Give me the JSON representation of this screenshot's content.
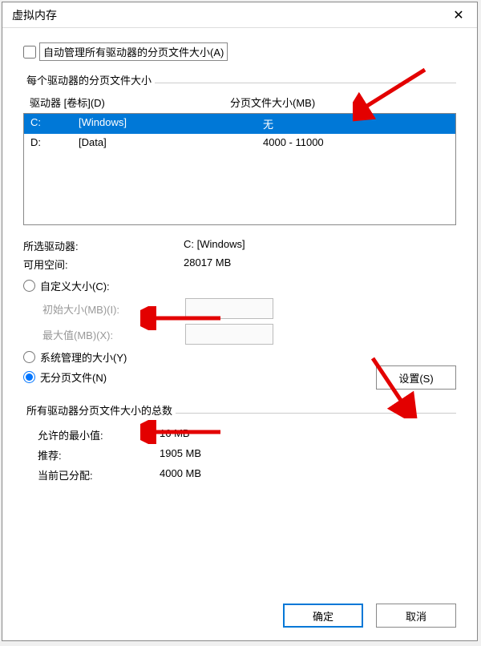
{
  "title": "虚拟内存",
  "auto_manage_label": "自动管理所有驱动器的分页文件大小(A)",
  "group1_label": "每个驱动器的分页文件大小",
  "drive_header_left": "驱动器 [卷标](D)",
  "drive_header_right": "分页文件大小(MB)",
  "drives": [
    {
      "letter": "C:",
      "label": "[Windows]",
      "size": "无",
      "selected": true
    },
    {
      "letter": "D:",
      "label": "[Data]",
      "size": "4000 - 11000",
      "selected": false
    }
  ],
  "selected_drive_label": "所选驱动器:",
  "selected_drive_value": "C:  [Windows]",
  "available_label": "可用空间:",
  "available_value": "28017 MB",
  "radio_custom": "自定义大小(C):",
  "initial_label": "初始大小(MB)(I):",
  "max_label": "最大值(MB)(X):",
  "radio_system": "系统管理的大小(Y)",
  "radio_none": "无分页文件(N)",
  "set_button": "设置(S)",
  "group2_label": "所有驱动器分页文件大小的总数",
  "min_label": "允许的最小值:",
  "min_value": "16 MB",
  "rec_label": "推荐:",
  "rec_value": "1905 MB",
  "cur_label": "当前已分配:",
  "cur_value": "4000 MB",
  "ok_button": "确定",
  "cancel_button": "取消"
}
